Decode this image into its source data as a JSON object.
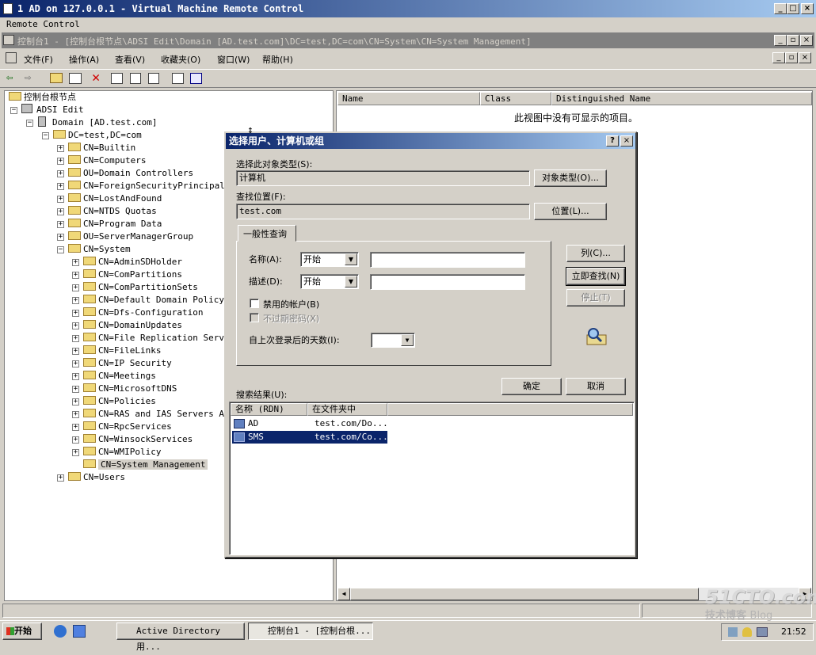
{
  "vm": {
    "title": "1 AD on 127.0.0.1 - Virtual Machine Remote Control",
    "menu": "Remote Control",
    "ctrl_min": "_",
    "ctrl_max": "□",
    "ctrl_close": "×"
  },
  "mmc": {
    "title": "控制台1 - [控制台根节点\\ADSI Edit\\Domain [AD.test.com]\\DC=test,DC=com\\CN=System\\CN=System Management]",
    "menu": [
      "文件(F)",
      "操作(A)",
      "查看(V)",
      "收藏夹(O)",
      "窗口(W)",
      "帮助(H)"
    ]
  },
  "tree": {
    "root": "控制台根节点",
    "adsi": "ADSI Edit",
    "domain": "Domain [AD.test.com]",
    "dc": "DC=test,DC=com",
    "children": [
      "CN=Builtin",
      "CN=Computers",
      "OU=Domain Controllers",
      "CN=ForeignSecurityPrincipals",
      "CN=LostAndFound",
      "CN=NTDS Quotas",
      "CN=Program Data",
      "OU=ServerManagerGroup",
      "CN=System"
    ],
    "system_children": [
      "CN=AdminSDHolder",
      "CN=ComPartitions",
      "CN=ComPartitionSets",
      "CN=Default Domain Policy",
      "CN=Dfs-Configuration",
      "CN=DomainUpdates",
      "CN=File Replication Service",
      "CN=FileLinks",
      "CN=IP Security",
      "CN=Meetings",
      "CN=MicrosoftDNS",
      "CN=Policies",
      "CN=RAS and IAS Servers Access",
      "CN=RpcServices",
      "CN=WinsockServices",
      "CN=WMIPolicy",
      "CN=System Management"
    ],
    "users": "CN=Users"
  },
  "list": {
    "columns": [
      "Name",
      "Class",
      "Distinguished Name"
    ],
    "empty_text": "此视图中没有可显示的项目。"
  },
  "dialog": {
    "title": "选择用户、计算机或组",
    "help": "?",
    "close": "×",
    "object_type_label": "选择此对象类型(S):",
    "object_type_value": "计算机",
    "object_type_button": "对象类型(O)...",
    "location_label": "查找位置(F):",
    "location_value": "test.com",
    "location_button": "位置(L)...",
    "tab": "一般性查询",
    "name_label": "名称(A):",
    "name_mode": "开始",
    "desc_label": "描述(D):",
    "desc_mode": "开始",
    "disabled_accounts": "禁用的帐户(B)",
    "non_expiring": "不过期密码(X)",
    "days_label": "自上次登录后的天数(I):",
    "columns_button": "列(C)...",
    "find_now_button": "立即查找(N)",
    "stop_button": "停止(T)",
    "ok_button": "确定",
    "cancel_button": "取消",
    "results_label": "搜索结果(U):",
    "result_columns": [
      "名称 (RDN)",
      "在文件夹中"
    ],
    "results": [
      {
        "name": "AD",
        "folder": "test.com/Do..."
      },
      {
        "name": "SMS",
        "folder": "test.com/Co..."
      }
    ]
  },
  "taskbar": {
    "start": "开始",
    "tasks": [
      "Active Directory 用...",
      "控制台1 - [控制台根..."
    ],
    "clock": "21:52"
  },
  "watermark": {
    "site": "51CTO.com",
    "sub": "技术博客",
    "blog": "Blog"
  },
  "colors": {
    "title_start": "#0a246a",
    "title_end": "#a6caf0",
    "selection": "#0a246a"
  }
}
